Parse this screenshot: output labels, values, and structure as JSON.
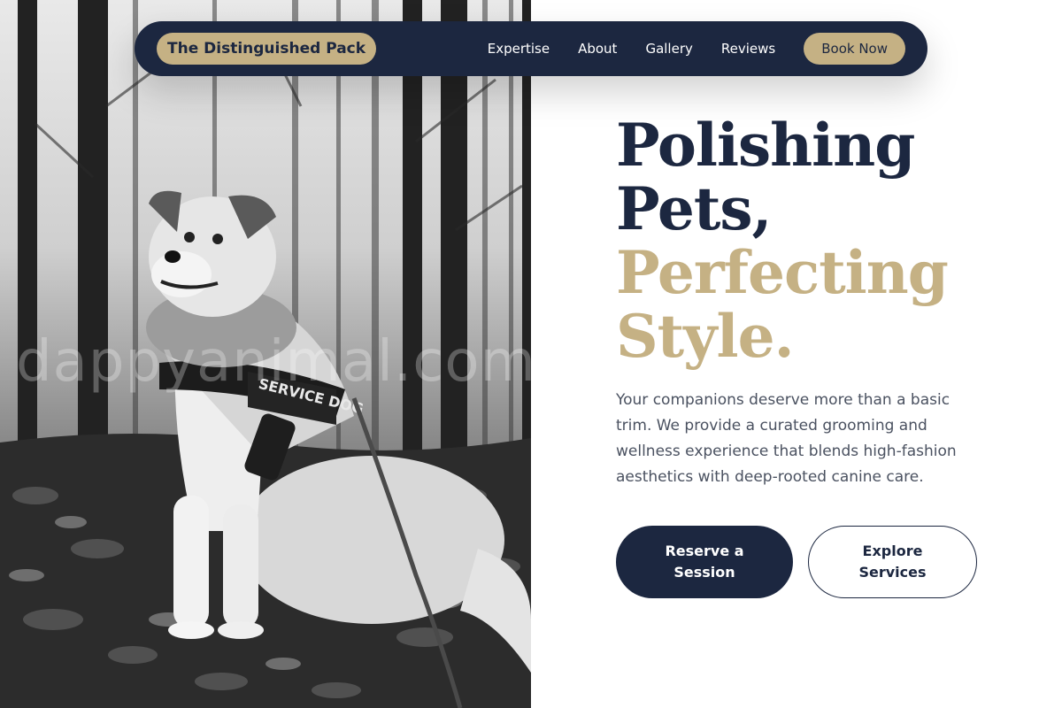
{
  "brand": {
    "name": "The Distinguished Pack"
  },
  "nav": {
    "links": [
      "Expertise",
      "About",
      "Gallery",
      "Reviews"
    ],
    "book_label": "Book Now"
  },
  "photo": {
    "watermark": "dappyanimal.com",
    "vest_text": "SERVICE DOG"
  },
  "hero": {
    "headline_line1": "Polishing",
    "headline_line2": "Pets,",
    "headline_line3": "Perfecting",
    "headline_line4": "Style.",
    "description": "Your companions deserve more than a basic trim. We provide a curated grooming and wellness experience that blends high-fashion aesthetics with deep-rooted canine care.",
    "primary_cta_line1": "Reserve a",
    "primary_cta_line2": "Session",
    "secondary_cta_line1": "Explore",
    "secondary_cta_line2": "Services"
  },
  "colors": {
    "navy": "#1c2740",
    "gold": "#c5b184",
    "body_text": "#4a5160",
    "background": "#ffffff"
  }
}
